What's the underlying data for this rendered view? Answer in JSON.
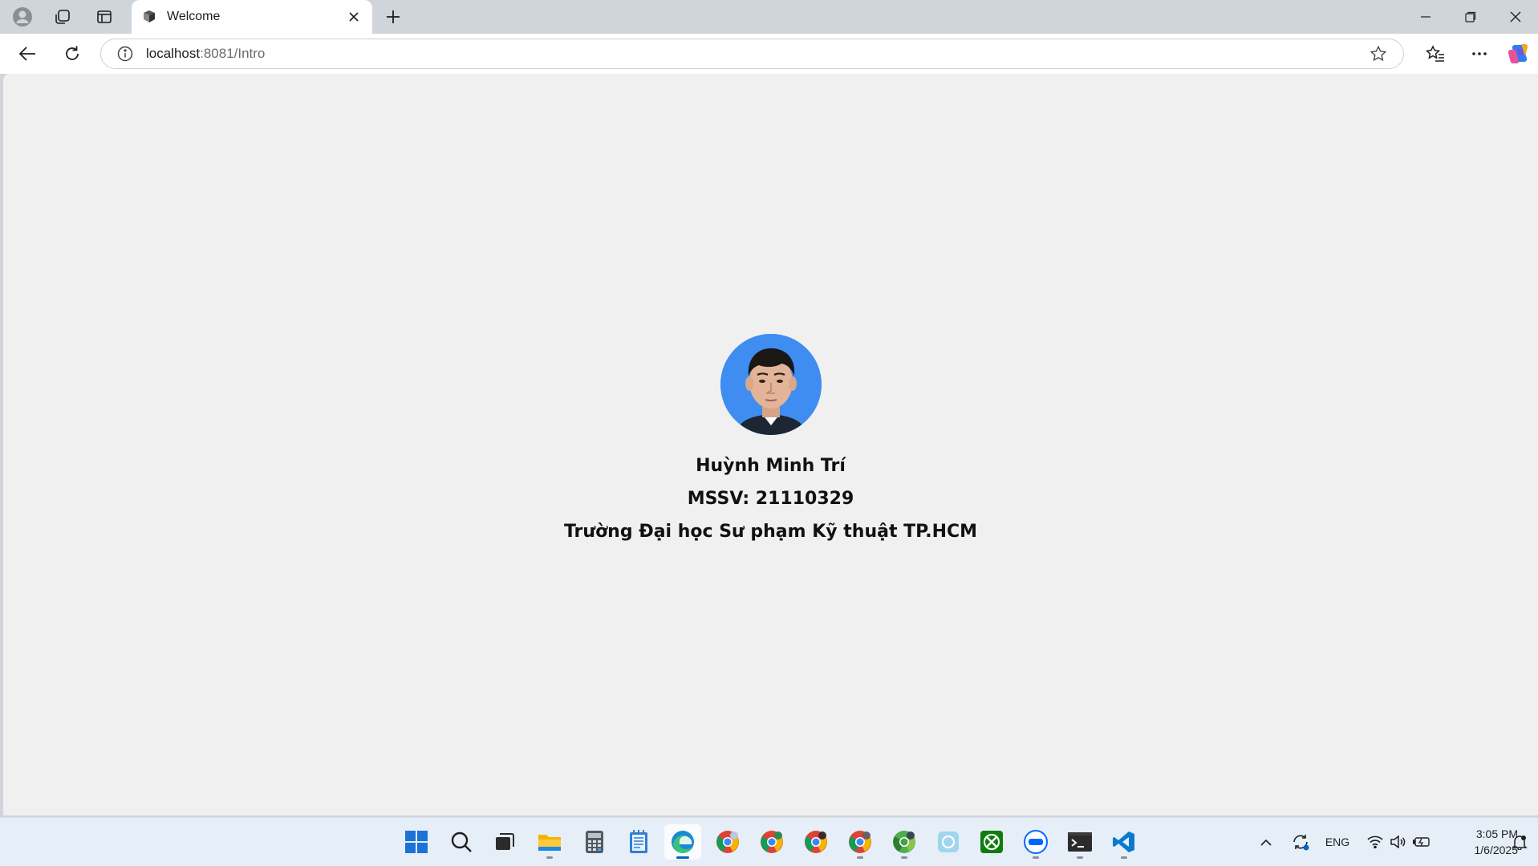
{
  "browser": {
    "tab": {
      "title": "Welcome"
    },
    "address": {
      "host": "localhost",
      "path": ":8081/Intro"
    }
  },
  "profile": {
    "name": "Huỳnh Minh Trí",
    "student_id": "MSSV: 21110329",
    "school": "Trường Đại học Sư phạm Kỹ thuật TP.HCM"
  },
  "taskbar": {
    "language": "ENG",
    "time": "3:05 PM",
    "date": "1/6/2025"
  },
  "colors": {
    "avatar_bg": "#3f8df0",
    "page_bg": "#f0f0f0",
    "accent": "#0067c0"
  }
}
